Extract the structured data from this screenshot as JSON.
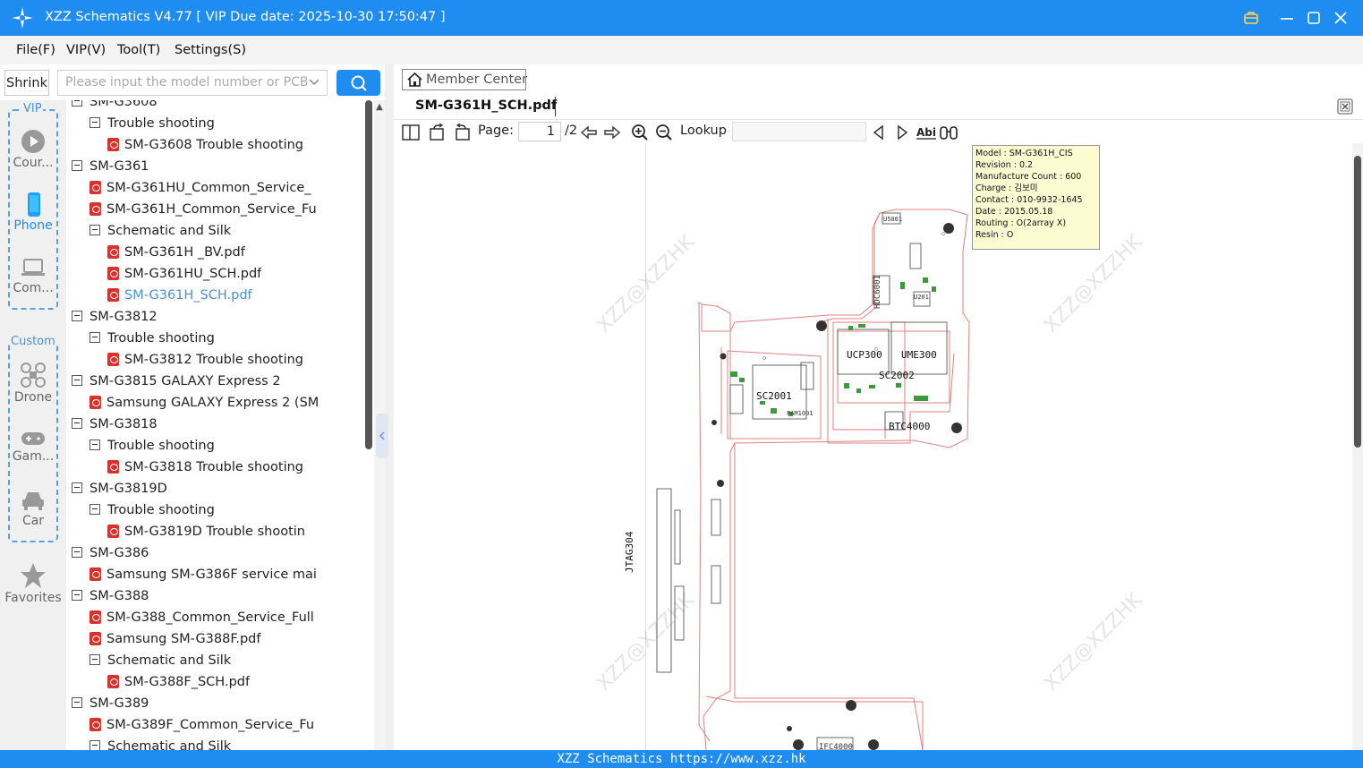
{
  "window": {
    "title": "XZZ Schematics V4.77 [ VIP Due date: 2025-10-30 17:50:47 ]",
    "brand_color": "#1e8cf0"
  },
  "menu": [
    "File(F)",
    "VIP(V)",
    "Tool(T)",
    "Settings(S)"
  ],
  "toolbar": {
    "shrink_label": "Shrink",
    "search_placeholder": "Please input the model number or PCB"
  },
  "rail": {
    "vip_label": "VIP",
    "custom_label": "Custom",
    "items": [
      {
        "label": "Cour...",
        "icon": "play-circle-icon"
      },
      {
        "label": "Phone",
        "icon": "phone-icon",
        "active": true
      },
      {
        "label": "Com...",
        "icon": "laptop-icon"
      },
      {
        "label": "Drone",
        "icon": "drone-icon"
      },
      {
        "label": "Gam...",
        "icon": "gamepad-icon"
      },
      {
        "label": "Car",
        "icon": "car-icon"
      },
      {
        "label": "Favorites",
        "icon": "star-icon"
      }
    ]
  },
  "tree": [
    {
      "label": "SM-G3608",
      "level": 0,
      "type": "folder"
    },
    {
      "label": "Trouble shooting",
      "level": 1,
      "type": "folder"
    },
    {
      "label": "SM-G3608 Trouble shooting",
      "level": 2,
      "type": "pdf"
    },
    {
      "label": "SM-G361",
      "level": 0,
      "type": "folder"
    },
    {
      "label": "SM-G361HU_Common_Service_",
      "level": 1,
      "type": "pdf"
    },
    {
      "label": "SM-G361H_Common_Service_Fu",
      "level": 1,
      "type": "pdf"
    },
    {
      "label": "Schematic and Silk",
      "level": 1,
      "type": "folder"
    },
    {
      "label": "SM-G361H _BV.pdf",
      "level": 2,
      "type": "pdf"
    },
    {
      "label": "SM-G361HU_SCH.pdf",
      "level": 2,
      "type": "pdf"
    },
    {
      "label": "SM-G361H_SCH.pdf",
      "level": 2,
      "type": "pdf",
      "active": true
    },
    {
      "label": "SM-G3812",
      "level": 0,
      "type": "folder"
    },
    {
      "label": "Trouble shooting",
      "level": 1,
      "type": "folder"
    },
    {
      "label": "SM-G3812 Trouble shooting",
      "level": 2,
      "type": "pdf"
    },
    {
      "label": "SM-G3815 GALAXY Express 2",
      "level": 0,
      "type": "folder"
    },
    {
      "label": "Samsung GALAXY Express 2 (SM",
      "level": 1,
      "type": "pdf"
    },
    {
      "label": "SM-G3818",
      "level": 0,
      "type": "folder"
    },
    {
      "label": "Trouble shooting",
      "level": 1,
      "type": "folder"
    },
    {
      "label": "SM-G3818 Trouble shooting",
      "level": 2,
      "type": "pdf"
    },
    {
      "label": "SM-G3819D",
      "level": 0,
      "type": "folder"
    },
    {
      "label": "Trouble shooting",
      "level": 1,
      "type": "folder"
    },
    {
      "label": "SM-G3819D Trouble shootin",
      "level": 2,
      "type": "pdf"
    },
    {
      "label": "SM-G386",
      "level": 0,
      "type": "folder"
    },
    {
      "label": "Samsung SM-G386F service mai",
      "level": 1,
      "type": "pdf"
    },
    {
      "label": "SM-G388",
      "level": 0,
      "type": "folder"
    },
    {
      "label": "SM-G388_Common_Service_Full",
      "level": 1,
      "type": "pdf"
    },
    {
      "label": "Samsung SM-G388F.pdf",
      "level": 1,
      "type": "pdf"
    },
    {
      "label": "Schematic and Silk",
      "level": 1,
      "type": "folder"
    },
    {
      "label": "SM-G388F_SCH.pdf",
      "level": 2,
      "type": "pdf"
    },
    {
      "label": "SM-G389",
      "level": 0,
      "type": "folder"
    },
    {
      "label": "SM-G389F_Common_Service_Fu",
      "level": 1,
      "type": "pdf"
    },
    {
      "label": "Schematic and Silk",
      "level": 1,
      "type": "folder"
    }
  ],
  "viewer": {
    "member_center": "Member Center",
    "tab_title": "SM-G361H_SCH.pdf",
    "page_label": "Page:",
    "page_current": "1",
    "page_total": "/2",
    "lookup_label": "Lookup",
    "lookup_value": ""
  },
  "info": {
    "model": "Model : SM-G361H_CIS",
    "revision": "Revision : 0.2",
    "manufacture_count": "Manufacture Count : 600",
    "charge": "Charge : 김보미",
    "contact": "Contact : 010-9932-1645",
    "date": "Date : 2015.05.18",
    "routing": "Routing : O(2array X)",
    "resin": "Resin : O"
  },
  "watermark": "XZZ@XZZHK",
  "pcb_labels": {
    "ucp": "UCP300",
    "ume": "UME300",
    "sc2002": "SC2002",
    "sc2001": "SC2001",
    "pam": "PAM1001",
    "btc": "BTC4000",
    "jtag": "JTAG304",
    "hdc": "HDC6001",
    "u201": "U201",
    "u5001": "U5001",
    "ifc": "IFC4000"
  },
  "status": "XZZ Schematics https://www.xzz.hk"
}
